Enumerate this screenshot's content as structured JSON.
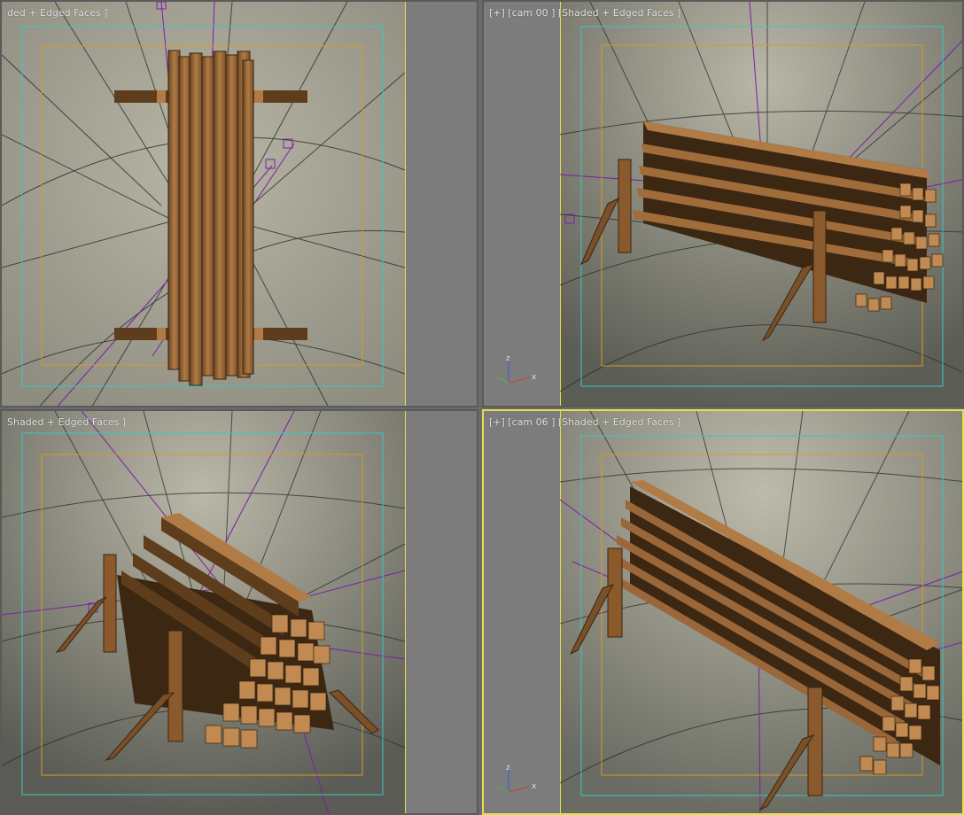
{
  "viewports": [
    {
      "id": "top-left",
      "label": "ded + Edged Faces ]",
      "active": false,
      "camera": "top"
    },
    {
      "id": "top-right",
      "label": "[+] [cam 00 ] [Shaded + Edged Faces ]",
      "active": false,
      "camera": "persp"
    },
    {
      "id": "bottom-left",
      "label": "Shaded + Edged Faces ]",
      "active": false,
      "camera": "persp2"
    },
    {
      "id": "bottom-right",
      "label": "[+] [cam 06 ] [Shaded + Edged Faces ]",
      "active": true,
      "camera": "persp3"
    }
  ],
  "axis_gizmo": {
    "x": "x",
    "y": "y",
    "z": "z"
  },
  "colors": {
    "viewport_bg": "#aaa99a",
    "grid": "#2b2b2b",
    "safe_frame_outer": "#39c7c9",
    "safe_frame_inner": "#d49a2a",
    "camera_lines": "#7b1fa2",
    "wood_light": "#b07b45",
    "wood_dark": "#5e3d1d",
    "active_border": "#e8e04a"
  }
}
